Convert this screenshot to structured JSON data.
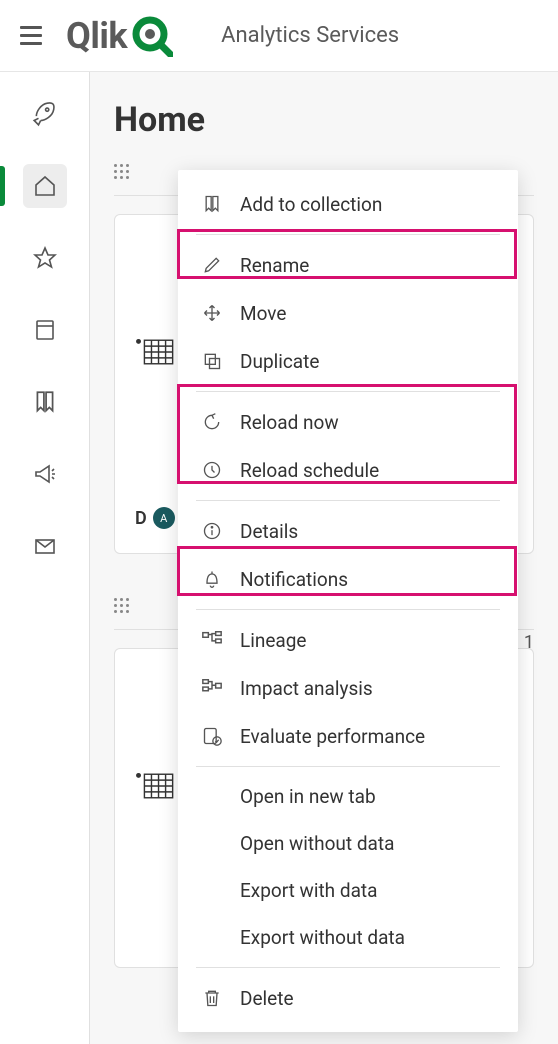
{
  "header": {
    "logo_text": "Qlik",
    "tenant": "Analytics Services"
  },
  "page": {
    "title": "Home",
    "card_label_prefix": "D",
    "avatar_initials": "A",
    "page_indicator": "1"
  },
  "menu": {
    "add_to_collection": "Add to collection",
    "rename": "Rename",
    "move": "Move",
    "duplicate": "Duplicate",
    "reload_now": "Reload now",
    "reload_schedule": "Reload schedule",
    "details": "Details",
    "notifications": "Notifications",
    "lineage": "Lineage",
    "impact_analysis": "Impact analysis",
    "evaluate_performance": "Evaluate performance",
    "open_new_tab": "Open in new tab",
    "open_without_data": "Open without data",
    "export_with_data": "Export with data",
    "export_without_data": "Export without data",
    "delete": "Delete"
  },
  "highlights": {
    "color": "#d6106f"
  }
}
